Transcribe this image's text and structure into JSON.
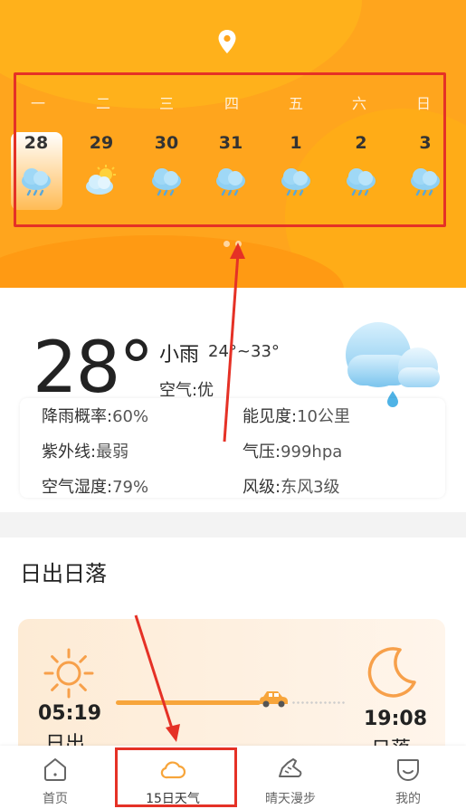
{
  "header": {
    "location_icon": "location-pin-icon",
    "weekdays": [
      "一",
      "二",
      "三",
      "四",
      "五",
      "六",
      "日"
    ],
    "dates": [
      "28",
      "29",
      "30",
      "31",
      "1",
      "2",
      "3"
    ],
    "icons": [
      "rain-cloud-icon",
      "partly-sunny-icon",
      "rain-cloud-icon",
      "rain-cloud-icon",
      "rain-cloud-icon",
      "rain-cloud-icon",
      "rain-cloud-icon"
    ],
    "selected_index": 0
  },
  "current": {
    "temperature": "28°",
    "condition": "小雨",
    "range": "24°~33°",
    "air": "空气:优",
    "icon": "cloud-rain-drop-icon"
  },
  "details": [
    {
      "label": "降雨概率:",
      "value": "60%"
    },
    {
      "label": "能见度:",
      "value": "10公里"
    },
    {
      "label": "紫外线:",
      "value": "最弱"
    },
    {
      "label": "气压:",
      "value": "999hpa"
    },
    {
      "label": "空气湿度:",
      "value": "79%"
    },
    {
      "label": "风级:",
      "value": "东风3级"
    }
  ],
  "sun": {
    "title": "日出日落",
    "sunrise_time": "05:19",
    "sunrise_label": "日出",
    "sunset_time": "19:08",
    "sunset_label": "日落"
  },
  "nav": [
    {
      "label": "首页",
      "icon": "home-icon"
    },
    {
      "label": "15日天气",
      "icon": "cloud-icon"
    },
    {
      "label": "晴天漫步",
      "icon": "sneaker-icon"
    },
    {
      "label": "我的",
      "icon": "smile-face-icon"
    }
  ],
  "colors": {
    "header_orange": "#ffa51d",
    "accent_orange": "#f7a53b",
    "highlight_red": "#e53126",
    "rain_blue": "#6fbde8"
  }
}
